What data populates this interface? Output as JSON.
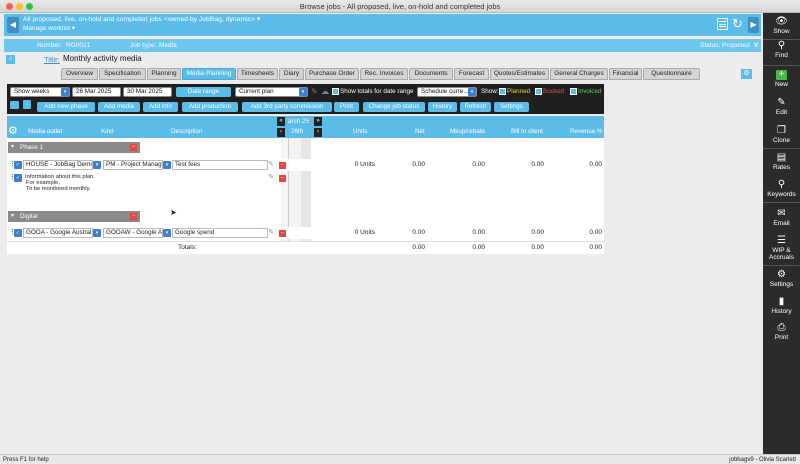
{
  "window": {
    "title": "Browse jobs - All proposed, live, on-hold and completed jobs"
  },
  "header": {
    "filter_title": "All proposed, live, on-hold and completed jobs <owned by JobBag, dynamic>",
    "manage_worklist": "Manage worklist"
  },
  "job": {
    "number_label": "Number:",
    "number": "RG0021",
    "type_label": "Job type:",
    "type": "Media",
    "status_label": "Status:",
    "status": "Proposed",
    "title_label": "Title:",
    "title": "Monthly activity media"
  },
  "tabs": [
    "Overview",
    "Specification",
    "Planning",
    "Media Planning",
    "Timesheets",
    "Diary",
    "Purchase Order",
    "Rec. Invoices",
    "Documents",
    "Forecast",
    "Quotes/Estimates",
    "General Charges",
    "Financial",
    "Questionnaire"
  ],
  "active_tab": "Media Planning",
  "toolbar": {
    "period": "Show weeks",
    "date_from": "26 Mar 2025",
    "date_to": "30 Mar 2025",
    "date_range_btn": "Date range",
    "plan": "Current plan",
    "show_totals": "Show totals for date range",
    "schedule": "Schedule curre...",
    "show_label": "Show:",
    "planned": "Planned",
    "booked": "Booked",
    "invoiced": "Invoiced",
    "buttons": [
      "Add new phase",
      "Add media",
      "Add info",
      "Add production",
      "Add 3rd party commission",
      "Print",
      "Change job status",
      "History",
      "Refresh",
      "Settings"
    ],
    "colors": {
      "planned": "#f2d43a",
      "booked": "#e24b4b",
      "invoiced": "#5fd35f"
    }
  },
  "grid": {
    "columns": {
      "media_outlet": "Media outlet",
      "kind": "Kind",
      "description": "Description",
      "units": "Units",
      "net": "Net",
      "mkup": "Mkup/rebate",
      "bill": "Bill to client",
      "revenue": "Revenue %"
    },
    "week_month": "arch 25",
    "week_day": "26th",
    "phases": [
      {
        "name": "Phase 1",
        "row": {
          "outlet": "HOUSE - JobBag Demo",
          "kind": "PM - Project Manage",
          "description": "Test fees",
          "units": "0 Units",
          "net": "0.00",
          "mkup": "0.00",
          "bill": "0.00",
          "revenue": "0.00"
        },
        "info": [
          "Information about this plan.",
          "For example,",
          "To be monitored monthly."
        ]
      },
      {
        "name": "Digital",
        "row": {
          "outlet": "GOOA - Google Australia",
          "kind": "GOOAW - Google Ad",
          "description": "Google spend",
          "units": "0 Units",
          "net": "0.00",
          "mkup": "0.00",
          "bill": "0.00",
          "revenue": "0.00"
        }
      }
    ],
    "totals": {
      "label": "Totals:",
      "net": "0.00",
      "mkup": "0.00",
      "bill": "0.00",
      "revenue": "0.00"
    }
  },
  "sidebar": {
    "show": "Show",
    "find": "Find",
    "new": "New",
    "edit": "Edit",
    "clone": "Clone",
    "rates": "Rates",
    "keywords": "Keywords",
    "email": "Email",
    "wip": "WIP &",
    "accruals": "Accruals",
    "settings": "Settings",
    "history": "History",
    "print": "Print"
  },
  "status": {
    "help": "Press F1 for help",
    "user": "jobbagv9 - Olivia Scarlett"
  }
}
